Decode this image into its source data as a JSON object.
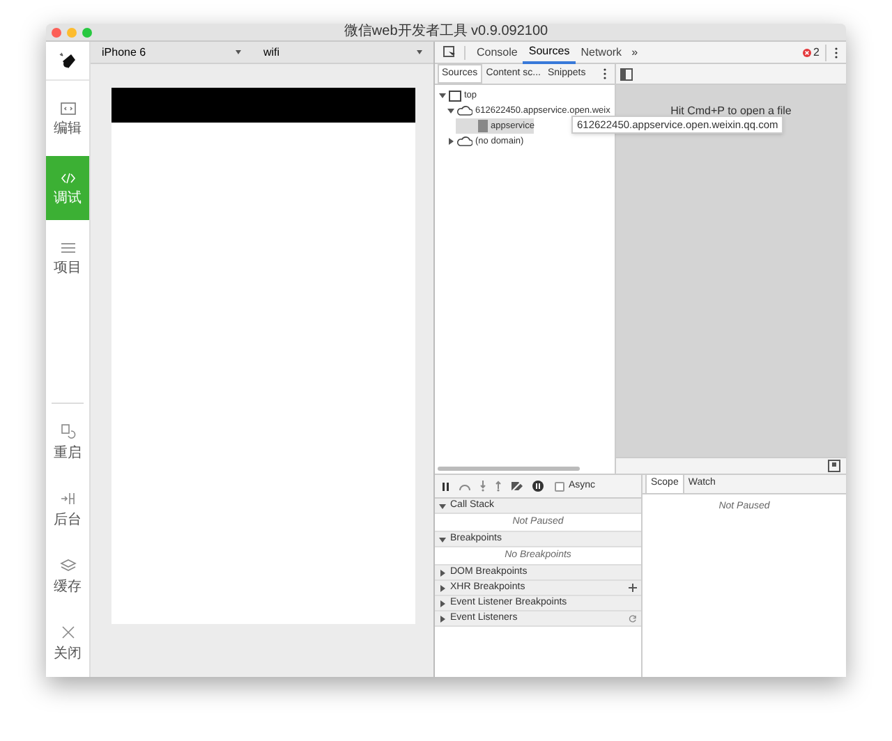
{
  "window": {
    "title": "微信web开发者工具 v0.9.092100"
  },
  "sidebar": {
    "items": [
      {
        "label": "编辑",
        "kind": "code-window",
        "selected": false
      },
      {
        "label": "调试",
        "kind": "code",
        "selected": true
      },
      {
        "label": "项目",
        "kind": "menu",
        "selected": false
      }
    ],
    "bottom_items": [
      {
        "label": "重启",
        "kind": "restart"
      },
      {
        "label": "后台",
        "kind": "background"
      },
      {
        "label": "缓存",
        "kind": "layers"
      },
      {
        "label": "关闭",
        "kind": "close"
      }
    ]
  },
  "simulator": {
    "device": "iPhone 6",
    "network": "wifi"
  },
  "devtools": {
    "tabs": [
      {
        "label": "Console",
        "selected": false
      },
      {
        "label": "Sources",
        "selected": true
      },
      {
        "label": "Network",
        "selected": false
      }
    ],
    "overflow": "»",
    "error_count": "2",
    "source_tabs": [
      {
        "label": "Sources",
        "selected": true
      },
      {
        "label": "Content sc...",
        "selected": false
      },
      {
        "label": "Snippets",
        "selected": false
      }
    ],
    "tree": [
      {
        "label": "top",
        "kind": "frame",
        "expanded": true,
        "children": [
          {
            "label": "612622450.appservice.open.weix",
            "kind": "cloud",
            "expanded": true,
            "children": [
              {
                "label": "appservice",
                "kind": "file",
                "selected": true
              }
            ]
          },
          {
            "label": "(no domain)",
            "kind": "cloud",
            "expanded": false
          }
        ]
      }
    ],
    "tooltip": "612622450.appservice.open.weixin.qq.com",
    "editor_hint": "Hit Cmd+P to open a file",
    "async": {
      "label": "Async",
      "checked": false
    },
    "sections": [
      {
        "label": "Call Stack",
        "expanded": true,
        "message": "Not Paused"
      },
      {
        "label": "Breakpoints",
        "expanded": true,
        "message": "No Breakpoints"
      },
      {
        "label": "DOM Breakpoints",
        "expanded": false
      },
      {
        "label": "XHR Breakpoints",
        "expanded": false,
        "add_button": true
      },
      {
        "label": "Event Listener Breakpoints",
        "expanded": false
      },
      {
        "label": "Event Listeners",
        "expanded": false,
        "refresh_button": true
      }
    ],
    "scope_tabs": [
      {
        "label": "Scope",
        "selected": true
      },
      {
        "label": "Watch",
        "selected": false
      }
    ],
    "scope_message": "Not Paused"
  }
}
